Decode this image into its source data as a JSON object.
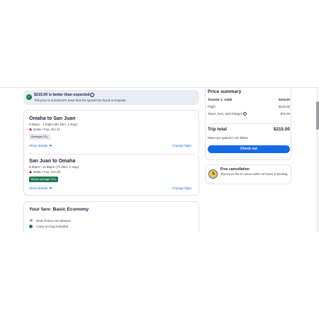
{
  "banner": {
    "title": "$215.00 is better than expected",
    "info_icon": "info-icon",
    "subtitle": "This price is at least 62% lower than the typical fare found on Expedia"
  },
  "flights": [
    {
      "route": "Omaha to San Juan",
      "times": "5:35am - 1:23pm (6h 48m, 1 stop)",
      "airline_date": "Delta • Tue, Oct 21",
      "co2_badge": "Average CO₂",
      "show_details": "Show details",
      "change": "Change flight"
    },
    {
      "route": "San Juan to Omaha",
      "times": "5:30pm - 11:56pm (7h 26m, 1 stop)",
      "airline_date": "Delta • Tue, Oct 28",
      "co2_badge": "Below average CO₂",
      "show_details": "Show details",
      "change": "Change flight"
    }
  ],
  "fare": {
    "title": "Your fare: Basic Economy",
    "items": [
      {
        "icon": "x-icon",
        "text": "Seat choice not allowed"
      },
      {
        "icon": "check-icon",
        "text": "Carry-on bag included"
      }
    ]
  },
  "summary": {
    "title": "Price summary",
    "traveler": "Traveler 1: Adult",
    "traveler_amount": "$215.00",
    "flight_label": "Flight",
    "flight_amount": "$140.00",
    "taxes_label": "Taxes, fees, and charges",
    "taxes_amount": "$75.00",
    "total_label": "Trip total",
    "total_amount": "$215.00",
    "note": "Rates are quoted in US dollars",
    "checkout": "Check out"
  },
  "cancellation": {
    "title": "Free cancellation",
    "text": "There's no fee to cancel within 24 hours of booking."
  },
  "colors": {
    "accent": "#1668e3",
    "success": "#227950",
    "banner_bg": "#e7ecf6"
  }
}
